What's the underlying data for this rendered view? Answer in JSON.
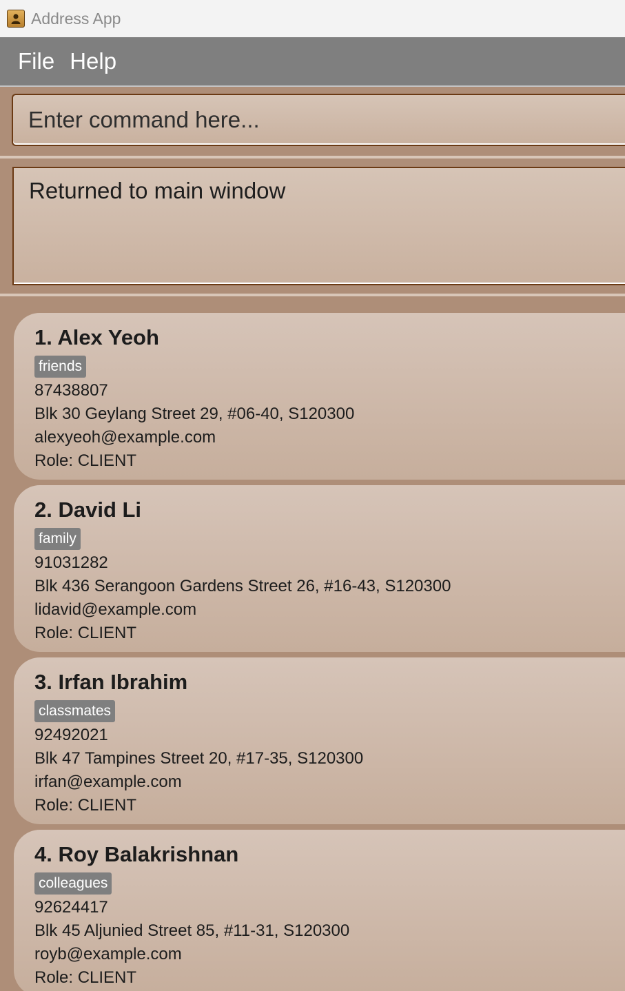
{
  "window": {
    "title": "Address App",
    "icon": "address-book-icon"
  },
  "menu": {
    "items": [
      "File",
      "Help"
    ]
  },
  "command": {
    "placeholder": "Enter command here..."
  },
  "result": {
    "text": "Returned to main window"
  },
  "persons": [
    {
      "name": "1. Alex Yeoh",
      "tag": "friends",
      "phone": "87438807",
      "address": "Blk 30 Geylang Street 29, #06-40, S120300",
      "email": "alexyeoh@example.com",
      "role": "Role: CLIENT"
    },
    {
      "name": "2. David Li",
      "tag": "family",
      "phone": "91031282",
      "address": "Blk 436 Serangoon Gardens Street 26, #16-43, S120300",
      "email": "lidavid@example.com",
      "role": "Role: CLIENT"
    },
    {
      "name": "3. Irfan Ibrahim",
      "tag": "classmates",
      "phone": "92492021",
      "address": "Blk 47 Tampines Street 20, #17-35, S120300",
      "email": "irfan@example.com",
      "role": "Role: CLIENT"
    },
    {
      "name": "4. Roy Balakrishnan",
      "tag": "colleagues",
      "phone": "92624417",
      "address": "Blk 45 Aljunied Street 85, #11-31, S120300",
      "email": "royb@example.com",
      "role": "Role: CLIENT"
    }
  ],
  "colors": {
    "menu_bar": "#7f7f7f",
    "background": "#ae8e78",
    "tag": "#7f7f7f",
    "input_border": "#6b3a14"
  }
}
